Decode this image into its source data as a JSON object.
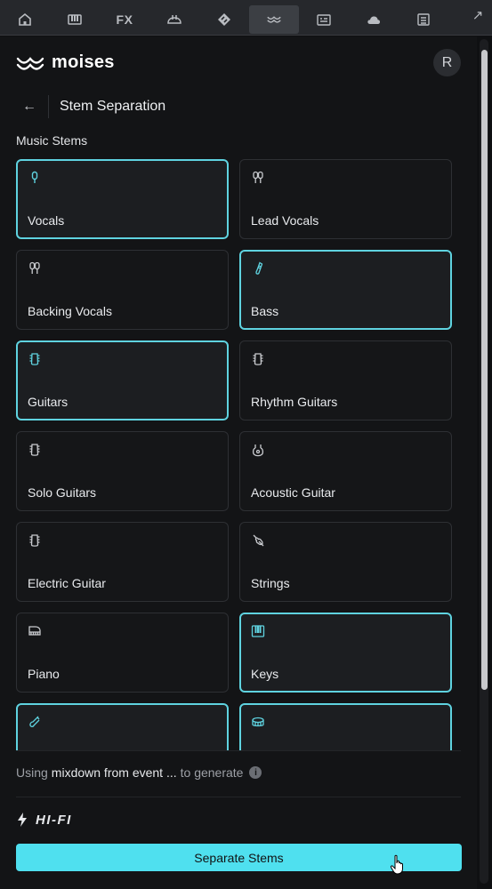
{
  "toolbar": {
    "items": [
      {
        "icon": "home-icon"
      },
      {
        "icon": "piano-icon"
      },
      {
        "icon": "fx-icon",
        "label": "FX"
      },
      {
        "icon": "mixer-icon"
      },
      {
        "icon": "tag-icon"
      },
      {
        "icon": "moises-icon",
        "active": true
      },
      {
        "icon": "browser-icon"
      },
      {
        "icon": "cloud-icon"
      },
      {
        "icon": "notes-icon"
      }
    ],
    "expand_icon": "expand-icon"
  },
  "brand": {
    "name": "moises"
  },
  "user": {
    "initial": "R"
  },
  "page": {
    "title": "Stem Separation",
    "back_icon": "back-arrow-icon"
  },
  "stems": {
    "section_label": "Music Stems",
    "items": [
      {
        "label": "Vocals",
        "icon": "microphone-icon",
        "selected": true
      },
      {
        "label": "Lead Vocals",
        "icon": "microphone-pair-icon",
        "selected": false
      },
      {
        "label": "Backing Vocals",
        "icon": "microphone-pair-icon",
        "selected": false
      },
      {
        "label": "Bass",
        "icon": "bass-icon",
        "selected": true
      },
      {
        "label": "Guitars",
        "icon": "guitar-head-icon",
        "selected": true
      },
      {
        "label": "Rhythm Guitars",
        "icon": "guitar-head-icon",
        "selected": false
      },
      {
        "label": "Solo Guitars",
        "icon": "guitar-head-icon",
        "selected": false
      },
      {
        "label": "Acoustic Guitar",
        "icon": "acoustic-guitar-icon",
        "selected": false
      },
      {
        "label": "Electric Guitar",
        "icon": "guitar-head-icon",
        "selected": false
      },
      {
        "label": "Strings",
        "icon": "violin-icon",
        "selected": false
      },
      {
        "label": "Piano",
        "icon": "grand-piano-icon",
        "selected": false
      },
      {
        "label": "Keys",
        "icon": "keys-icon",
        "selected": true
      },
      {
        "label": "",
        "icon": "wind-icon",
        "selected": true
      },
      {
        "label": "",
        "icon": "drum-icon",
        "selected": true
      }
    ]
  },
  "source": {
    "prefix": "Using",
    "name": "mixdown from event ...",
    "suffix": "to generate",
    "info_icon": "info-icon"
  },
  "quality": {
    "label": "HI-FI",
    "icon": "lightning-icon"
  },
  "actions": {
    "separate_label": "Separate Stems"
  },
  "colors": {
    "accent": "#4fe0ef",
    "selected_border": "#5fd3e0",
    "background": "#131416"
  }
}
